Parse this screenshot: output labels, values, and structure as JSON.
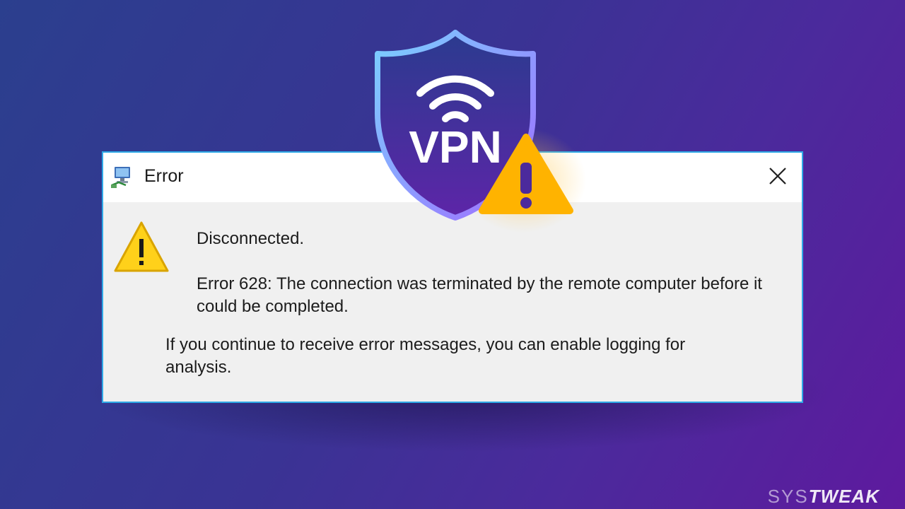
{
  "dialog": {
    "title": "Error",
    "message_title": "Disconnected.",
    "error_text": "Error 628: The connection was terminated by the remote computer before it could be completed.",
    "info_text": "If you continue to receive error messages, you can enable logging for analysis."
  },
  "badge": {
    "label": "VPN"
  },
  "brand": {
    "prefix": "SYS",
    "name": "TWEAK"
  },
  "colors": {
    "dialog_border": "#2ea8e6",
    "warning_fill": "#ffc107",
    "shield_outline": "#7fb6ff",
    "shield_fill_top": "#2b3b8f",
    "shield_fill_bottom": "#5d25a8"
  },
  "icons": [
    "network-computer-icon",
    "close-icon",
    "warning-icon",
    "vpn-shield-icon",
    "wifi-icon",
    "alert-triangle-icon"
  ]
}
